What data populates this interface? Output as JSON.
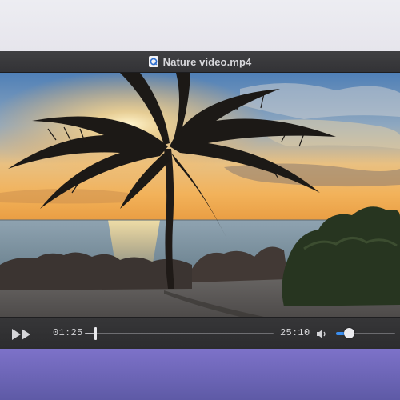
{
  "window": {
    "title": "Nature video.mp4",
    "file_icon": "quicktime-file-icon"
  },
  "player": {
    "fast_forward_icon": "fast-forward-icon",
    "current_time": "01:25",
    "duration": "25:10",
    "progress_fraction": 0.056,
    "volume_icon": "speaker-icon",
    "volume_fraction": 0.22
  },
  "colors": {
    "volume_accent": "#3a8ef0",
    "desktop_bottom": "#6f66bb",
    "titlebar": "#39393c"
  }
}
